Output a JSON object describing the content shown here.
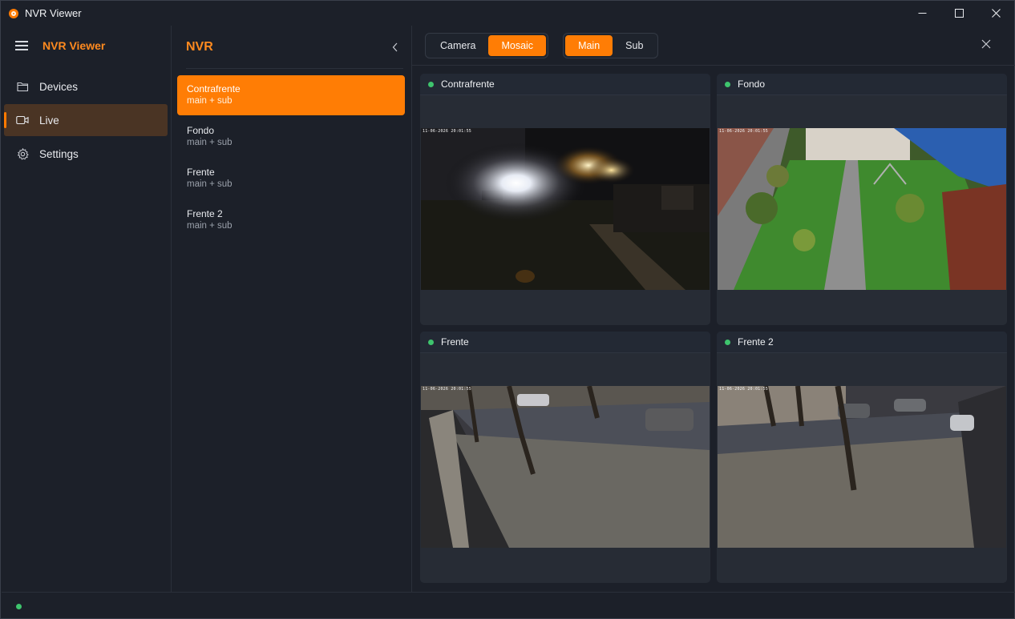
{
  "window": {
    "title": "NVR Viewer",
    "controls": [
      "minimize-icon",
      "maximize-icon",
      "close-icon"
    ]
  },
  "colors": {
    "accent": "#ff7d05",
    "online": "#3ec46d",
    "background": "#1c2029"
  },
  "nav": {
    "title": "NVR Viewer",
    "menu_icon": "hamburger-icon",
    "items": [
      {
        "label": "Devices",
        "icon": "folder-icon",
        "active": false
      },
      {
        "label": "Live",
        "icon": "video-camera-icon",
        "active": true
      },
      {
        "label": "Settings",
        "icon": "gear-icon",
        "active": false
      }
    ]
  },
  "device_panel": {
    "title": "NVR",
    "collapse_icon": "chevron-left-icon",
    "devices": [
      {
        "name": "Contrafrente",
        "streams": "main + sub",
        "selected": true
      },
      {
        "name": "Fondo",
        "streams": "main + sub",
        "selected": false
      },
      {
        "name": "Frente",
        "streams": "main + sub",
        "selected": false
      },
      {
        "name": "Frente 2",
        "streams": "main + sub",
        "selected": false
      }
    ]
  },
  "toolbar": {
    "view_mode": {
      "options": [
        "Camera",
        "Mosaic"
      ],
      "selected": "Mosaic"
    },
    "stream": {
      "options": [
        "Main",
        "Sub"
      ],
      "selected": "Main"
    },
    "close_icon": "close-icon"
  },
  "mosaic": {
    "tiles": [
      {
        "name": "Contrafrente",
        "status": "online",
        "timestamp": "11-06-2026 20:01:55"
      },
      {
        "name": "Fondo",
        "status": "online",
        "timestamp": "11-06-2026 20:01:55"
      },
      {
        "name": "Frente",
        "status": "online",
        "timestamp": "11-06-2026 20:01:55"
      },
      {
        "name": "Frente 2",
        "status": "online",
        "timestamp": "11-06-2026 20:01:55"
      }
    ]
  },
  "footer": {
    "status": "online"
  }
}
